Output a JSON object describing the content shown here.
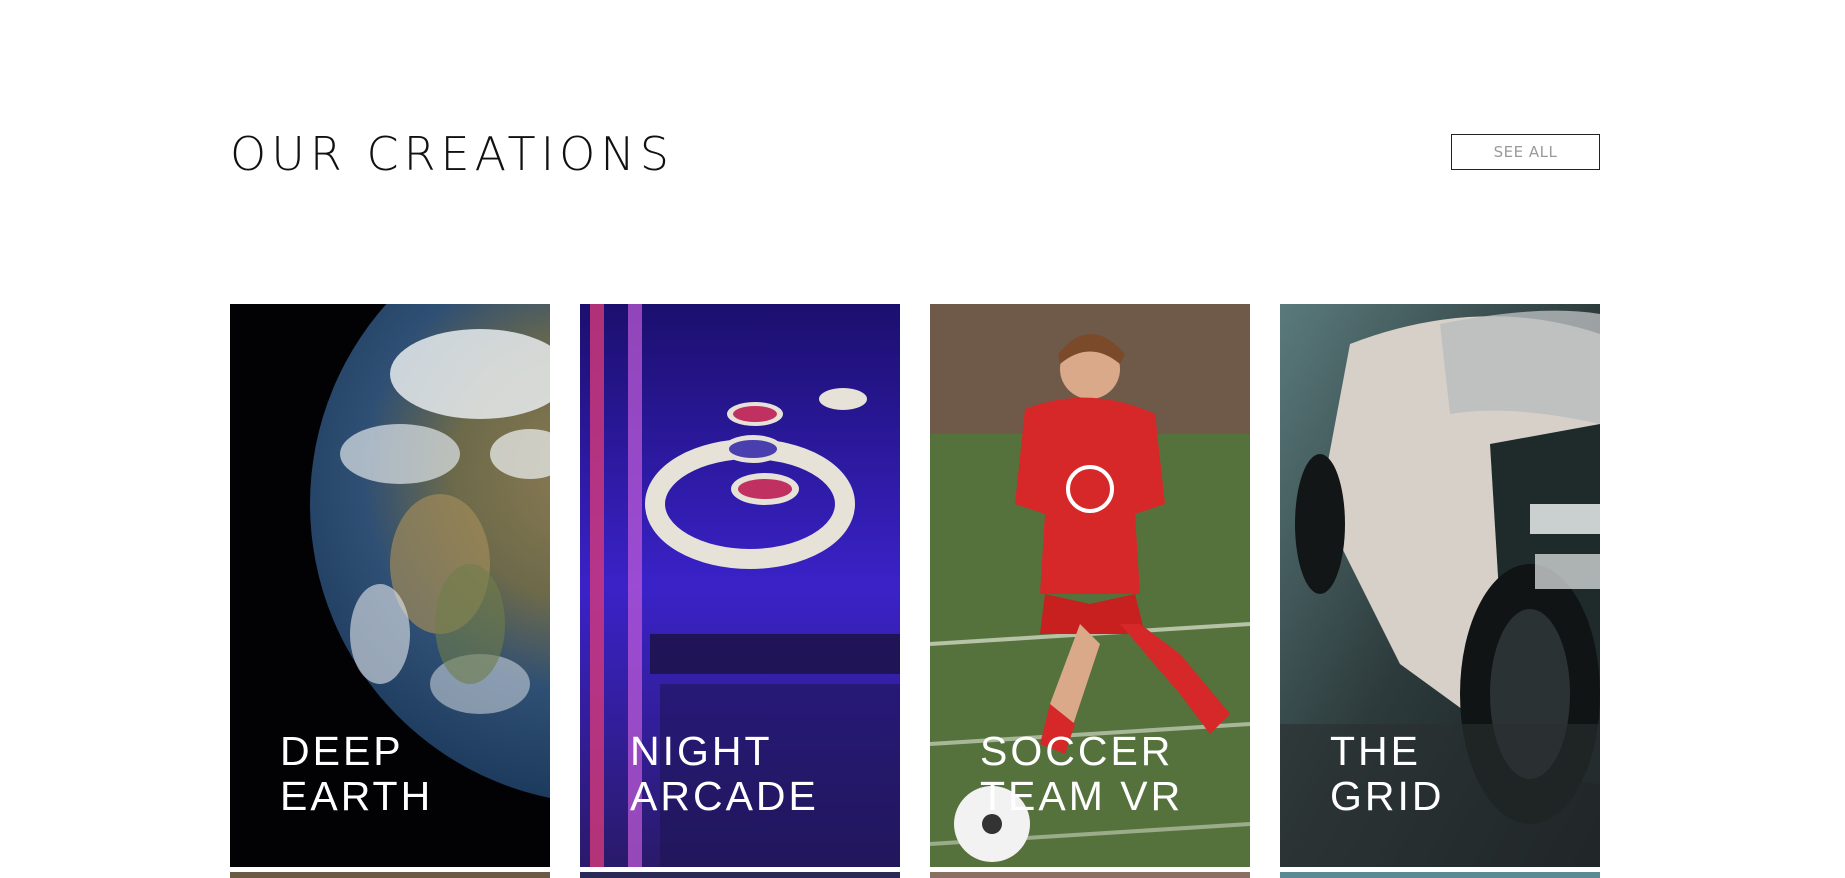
{
  "section": {
    "title": "OUR CREATIONS",
    "see_all_label": "SEE ALL"
  },
  "cards": [
    {
      "title_line1": "DEEP",
      "title_line2": "EARTH"
    },
    {
      "title_line1": "NIGHT",
      "title_line2": "ARCADE"
    },
    {
      "title_line1": "SOCCER",
      "title_line2": "TEAM  VR"
    },
    {
      "title_line1": "THE",
      "title_line2": "GRID"
    }
  ],
  "colors": {
    "page_bg": "#ffffff",
    "title_text": "#111111",
    "button_border": "#222222",
    "button_text": "#9a9a9a",
    "card_text": "#ffffff"
  }
}
